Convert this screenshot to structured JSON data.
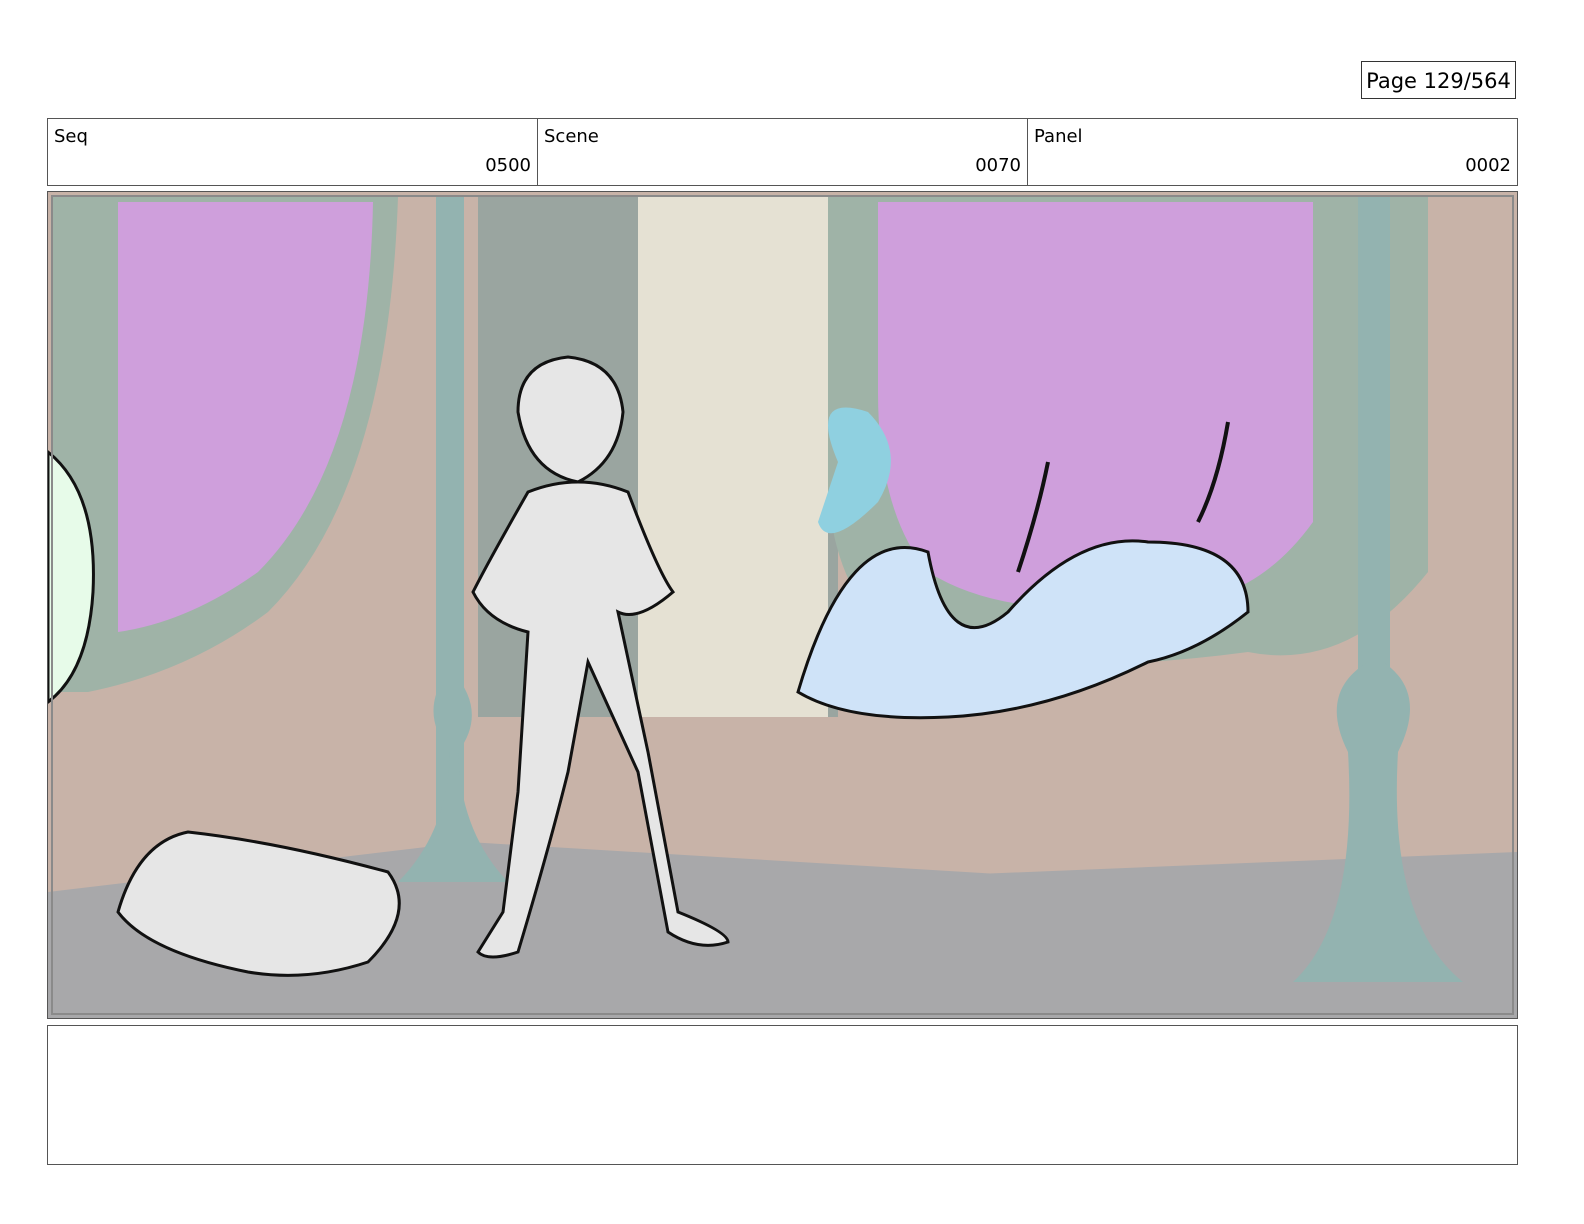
{
  "page": {
    "label": "Page 129/564"
  },
  "header": {
    "seq": {
      "label": "Seq",
      "value": "0500"
    },
    "scene": {
      "label": "Scene",
      "value": "0070"
    },
    "panel": {
      "label": "Panel",
      "value": "0002"
    }
  },
  "notes": {
    "text": ""
  },
  "colors": {
    "wall": "#c8b3a8",
    "window": "#cf9fdc",
    "pillar": "#93b3b0",
    "floor": "#a8a8aa",
    "creature": "#cfe3f8"
  }
}
